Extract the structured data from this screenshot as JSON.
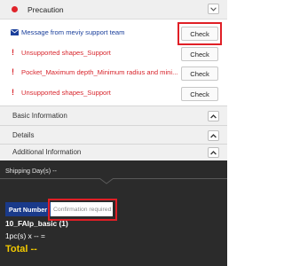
{
  "precaution": {
    "title": "Precaution",
    "messages": [
      {
        "text": "Message from meviy support team",
        "button": "Check",
        "type": "info",
        "icon": "mail-icon"
      },
      {
        "text": "Unsupported shapes_Support",
        "button": "Check",
        "type": "warning",
        "icon": "exclamation-icon"
      },
      {
        "text": "Pocket_Maximum depth_Minimum radius and mini...",
        "button": "Check",
        "type": "warning",
        "icon": "exclamation-icon"
      },
      {
        "text": "Unsupported shapes_Support",
        "button": "Check",
        "type": "warning",
        "icon": "exclamation-icon"
      }
    ]
  },
  "sections": [
    {
      "label": "Basic Information",
      "icon": "chevron-up-icon"
    },
    {
      "label": "Details",
      "icon": "chevron-up-icon"
    },
    {
      "label": "Additional Information",
      "icon": "chevron-up-icon"
    }
  ],
  "summary": {
    "shipping": "Shipping Day(s) --",
    "part_number_label": "Part Number",
    "part_number_placeholder": "Confirmation required",
    "part_id": "10_FAlp_basic (1)",
    "quantity": "1pc(s) x -- =",
    "total": "Total --"
  },
  "colors": {
    "accent_red": "#e01f26",
    "link_blue": "#1a3f9b",
    "panel_dark": "#2b2b2b",
    "total_yellow": "#f2c900",
    "part_label_blue": "#1a3a8a"
  }
}
